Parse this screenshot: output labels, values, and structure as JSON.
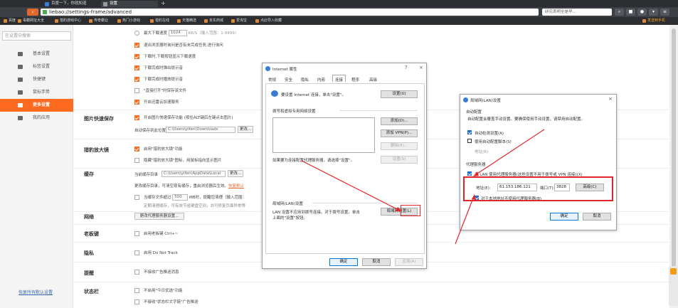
{
  "browser": {
    "tabs": [
      {
        "label": "百度一下，你就知道"
      },
      {
        "label": "设置"
      }
    ],
    "new_tab": "+",
    "address": "liebao://settings-frame/advanced",
    "search_placeholder": "研究表明全是早...",
    "bookmarks": [
      "百度",
      "毒霸网址大全",
      "猎豹游戏中心",
      "传奇霸业",
      "热门小游戏",
      "猎豹在线",
      "天猫精选",
      "京东商城",
      "爱淘宝",
      "点此导入收藏"
    ],
    "right_link": "发送到手机"
  },
  "sidebar": {
    "search_placeholder": "在设置中搜索",
    "items": [
      {
        "label": "基本设置"
      },
      {
        "label": "标签设置"
      },
      {
        "label": "快捷键"
      },
      {
        "label": "鼠标手势"
      },
      {
        "label": "更多设置"
      },
      {
        "label": "我的应用"
      }
    ],
    "restore": "恢复所有默认设置"
  },
  "settings": {
    "download": {
      "speed_limit_label": "最大下载速度",
      "speed_value": "1024",
      "speed_unit": "KB/S（输入范围：1-9999）",
      "opt1": "退出浏览器时询问是否有未完成任务,进行询问",
      "opt2": "下载时,下载按钮显示下载速度",
      "opt3": "下载完成时弹出提示音",
      "opt4": "下载完成时播放提示音",
      "opt5": "\"直接打开\"时保存该文件",
      "opt6": "开启迅雷云加速服务"
    },
    "image_save": {
      "title": "图片快速保存",
      "opt": "开启图片快速保存功能 (按住ALT键后左键点击图片)",
      "path_label": "自动保存到此位置",
      "path": "C:\\Users\\yifen\\Downloads",
      "change_btn": "更改..."
    },
    "zoom": {
      "title": "猎豹放大镜",
      "opt1": "启用\"猎豹放大镜\"功能",
      "opt2": "隐藏\"猎豹放大镜\"图标，用鼠标指向显示图片"
    },
    "cache": {
      "title": "缓存",
      "path_label": "当前缓存目录",
      "path": "C:\\Users\\yifen\\AppData\\Local",
      "change_btn": "更改...",
      "note": "更改缓存目录，可清空现有缓存，重启浏览器后生效。",
      "note_link": "恢复默认",
      "limit_prefix": "当缓存文件超过",
      "limit_value": "500",
      "limit_suffix": "MB时，提醒您清理（输入范围：",
      "limit_note": "定期清理缓存，可有效节省硬盘空间，并可修复页面异常等"
    },
    "network": {
      "title": "网络",
      "btn": "更改代理服务器设置..."
    },
    "boss_key": {
      "title": "老板键",
      "opt": "启用老板键 Ctrl+~"
    },
    "privacy": {
      "title": "隐私",
      "opt": "启用 Do Not Track"
    },
    "remind": {
      "title": "提醒",
      "opt": "不接收广告推送消息"
    },
    "status_bar": {
      "title": "状态栏",
      "opt1": "不启用\"今日优选\"功能",
      "opt2": "不接收\"状态栏文字链\"广告推送"
    }
  },
  "internet_options": {
    "title": "Internet 属性",
    "help": "?",
    "close": "×",
    "tabs": [
      "常规",
      "安全",
      "隐私",
      "内容",
      "连接",
      "程序",
      "高级"
    ],
    "setup_text": "要设置 Internet 连接，单击\"设置\"。",
    "setup_btn": "设置(U)",
    "dialup_title": "拨号和虚拟专用网络设置",
    "add_btn": "添加(D)...",
    "add_vpn_btn": "添加 VPN(P)...",
    "remove_btn": "删除(R)...",
    "settings_btn": "设置(S)",
    "proxy_hint": "如果要为连接配置代理服务器，请选择\"设置\"。",
    "lan_title": "局域网(LAN)设置",
    "lan_text1": "LAN 设置不应用到拨号连接。对于拨号设置，单击",
    "lan_text2": "上面的\"设置\"按钮。",
    "lan_btn": "局域网设置(L)",
    "ok": "确定",
    "cancel": "取消",
    "apply": "应用(A)"
  },
  "lan_dialog": {
    "title": "局域网(LAN)设置",
    "close": "×",
    "auto_title": "自动配置",
    "auto_text": "自动配置会覆盖手动设置。要确保使用手动设置，请禁用自动配置。",
    "auto_detect": "自动检测设置(A)",
    "use_script": "使用自动配置脚本(S)",
    "address_label": "地址(R)",
    "proxy_title": "代理服务器",
    "use_proxy": "为 LAN 使用代理服务器(这些设置不用于拨号或 VPN 连接)(X)",
    "addr_label": "地址(E):",
    "addr_value": "61.153.186.121",
    "port_label": "端口(T):",
    "port_value": "3828",
    "advanced_btn": "高级(C)",
    "bypass": "对于本地地址不使用代理服务器(B)",
    "ok": "确定",
    "cancel": "取消"
  },
  "colors": {
    "accent": "#ff6a21",
    "highlight": "#e0262a"
  }
}
